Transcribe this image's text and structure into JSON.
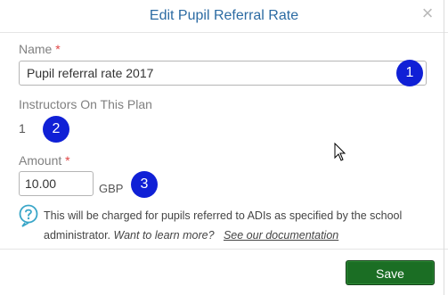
{
  "dialog": {
    "title": "Edit Pupil Referral Rate",
    "close_icon": "close-icon"
  },
  "form": {
    "name_label": "Name",
    "required_mark": "*",
    "name_value": "Pupil referral rate 2017",
    "instructors_label": "Instructors On This Plan",
    "instructors_value": "1",
    "amount_label": "Amount",
    "amount_value": "10.00",
    "currency": "GBP"
  },
  "help": {
    "icon": "help-icon",
    "text": "This will be charged for pupils referred to ADIs as specified by the school administrator.",
    "learn_more": "Want to learn more?",
    "link": "See our documentation"
  },
  "footer": {
    "save_label": "Save"
  },
  "badges": [
    "1",
    "2",
    "3"
  ],
  "colors": {
    "title": "#2c6ba3",
    "required": "#e04545",
    "save_bg": "#1b6e24",
    "badge_bg": "#1020d6"
  }
}
